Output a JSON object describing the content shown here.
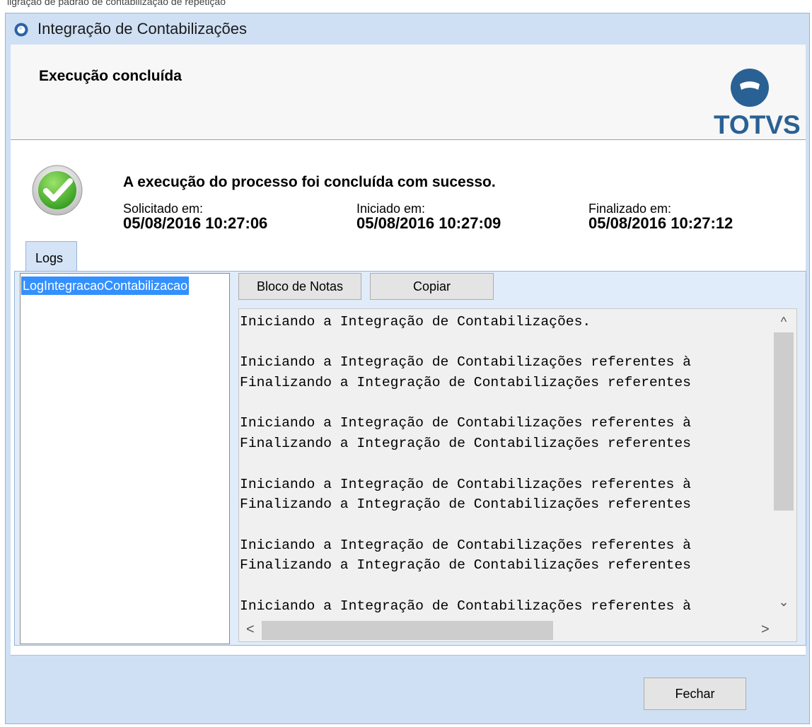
{
  "window": {
    "title": "Integração de Contabilizações",
    "clipped_top_text": "ligração de padrão de contabilização de repetição"
  },
  "header": {
    "title": "Execução concluída",
    "logo_text": "TOTVS",
    "logo_color": "#2a6194"
  },
  "status": {
    "icon": "success-check-icon",
    "message": "A execução do processo foi concluída com sucesso.",
    "solicitado_label": "Solicitado em:",
    "solicitado_value": "05/08/2016 10:27:06",
    "iniciado_label": "Iniciado em:",
    "iniciado_value": "05/08/2016 10:27:09",
    "finalizado_label": "Finalizado em:",
    "finalizado_value": "05/08/2016 10:27:12"
  },
  "tabs": [
    {
      "label": "Logs",
      "selected": true
    }
  ],
  "log_list": {
    "items": [
      "LogIntegracaoContabilizacao"
    ],
    "selected_index": 0
  },
  "toolbar": {
    "bloco_label": "Bloco de Notas",
    "copiar_label": "Copiar"
  },
  "log_lines": [
    "Iniciando a Integração de Contabilizações.",
    "",
    "Iniciando a Integração de Contabilizações referentes à",
    "Finalizando a Integração de Contabilizações referentes",
    "",
    "Iniciando a Integração de Contabilizações referentes à",
    "Finalizando a Integração de Contabilizações referentes",
    "",
    "Iniciando a Integração de Contabilizações referentes à",
    "Finalizando a Integração de Contabilizações referentes",
    "",
    "Iniciando a Integração de Contabilizações referentes à",
    "Finalizando a Integração de Contabilizações referentes",
    "",
    "Iniciando a Integração de Contabilizações referentes à"
  ],
  "footer": {
    "close_label": "Fechar"
  },
  "scroll_arrows": {
    "up": "^",
    "down": "⌄",
    "left": "<",
    "right": ">"
  }
}
